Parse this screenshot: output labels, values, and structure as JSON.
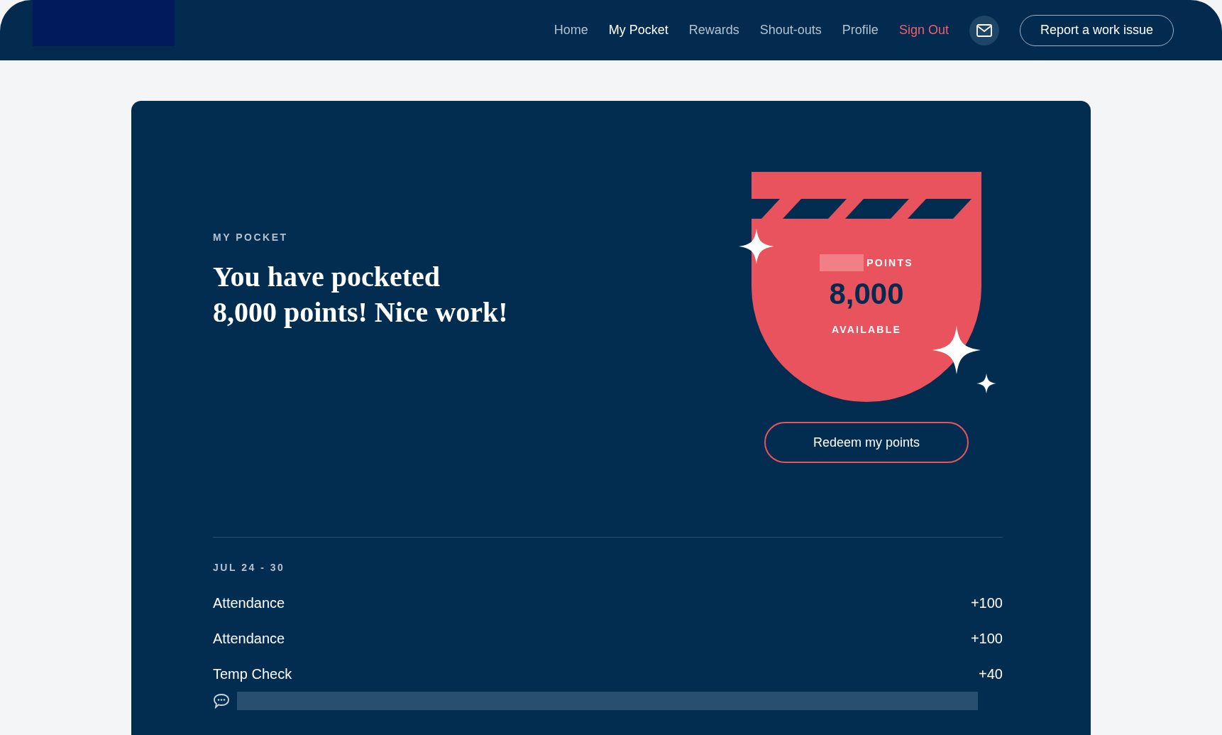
{
  "nav": {
    "items": [
      {
        "label": "Home",
        "selected": false,
        "kind": "link"
      },
      {
        "label": "My Pocket",
        "selected": true,
        "kind": "link"
      },
      {
        "label": "Rewards",
        "selected": false,
        "kind": "link"
      },
      {
        "label": "Shout-outs",
        "selected": false,
        "kind": "link"
      },
      {
        "label": "Profile",
        "selected": false,
        "kind": "link"
      },
      {
        "label": "Sign Out",
        "selected": false,
        "kind": "signout"
      }
    ],
    "report_button": "Report a work issue"
  },
  "hero": {
    "eyebrow": "MY POCKET",
    "heading_lines": [
      "You have pocketed",
      "8,000 points! Nice work!"
    ]
  },
  "badge": {
    "label_top": "POINTS",
    "amount": "8,000",
    "label_bottom": "AVAILABLE"
  },
  "redeem_button": "Redeem my points",
  "history": {
    "period": "JUL 24 - 30",
    "items": [
      {
        "name": "Attendance",
        "points": "+100",
        "has_comment": false
      },
      {
        "name": "Attendance",
        "points": "+100",
        "has_comment": false
      },
      {
        "name": "Temp Check",
        "points": "+40",
        "has_comment": true
      }
    ]
  }
}
